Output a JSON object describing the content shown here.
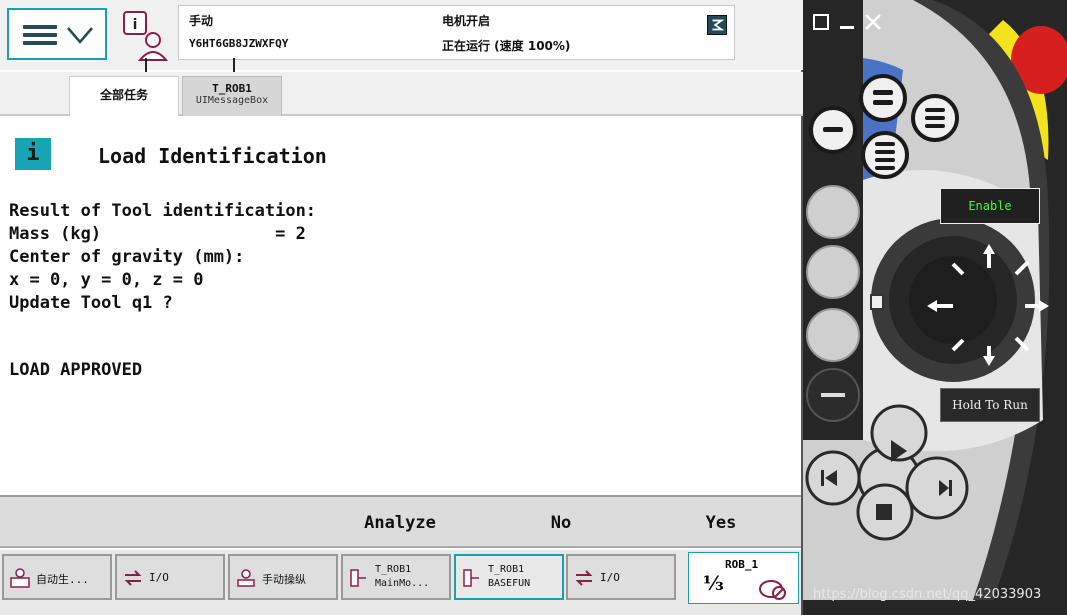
{
  "topbar": {
    "mode": "手动",
    "system_name": "Y6HT6GB8JZWXFQY",
    "motor_status": "电机开启",
    "run_status": "正在运行 (速度 100%)"
  },
  "tabs": [
    {
      "label": "全部任务"
    },
    {
      "label": "T_ROB1",
      "sub": "UIMessageBox"
    }
  ],
  "message": {
    "icon": "i",
    "title": "Load Identification",
    "body": "Result of Tool identification:\nMass (kg)                 = 2\nCenter of gravity (mm):\nx = 0, y = 0, z = 0\nUpdate Tool q1 ?",
    "footer": "LOAD APPROVED"
  },
  "buttons": {
    "analyze": "Analyze",
    "no": "No",
    "yes": "Yes"
  },
  "taskbar": [
    {
      "label": "自动生...",
      "icon": "production-icon"
    },
    {
      "label": "I/O",
      "icon": "io-icon"
    },
    {
      "label": "手动操纵",
      "icon": "jogging-icon"
    },
    {
      "line1": "T_ROB1",
      "line2": "MainMo...",
      "icon": "program-icon"
    },
    {
      "line1": "T_ROB1",
      "line2": "BASEFUN",
      "icon": "program-icon"
    },
    {
      "label": "I/O",
      "icon": "io-icon"
    }
  ],
  "rob": {
    "label": "ROB_1",
    "fraction": "⅓"
  },
  "pendant": {
    "enable_label": "Enable",
    "hold_label": "Hold To Run"
  },
  "watermark": "https://blog.csdn.net/qq_42033903",
  "colors": {
    "accent": "#1b9fb0",
    "pendant_blue": "#4b73c5",
    "emergency_red": "#d62020",
    "enable_yellow": "#f2e31a"
  }
}
